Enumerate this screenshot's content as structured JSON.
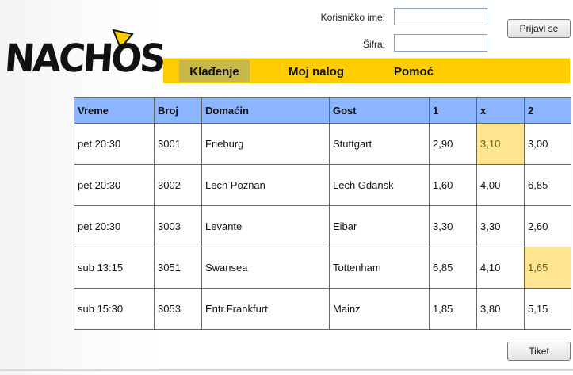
{
  "brand": {
    "logo_text": "NACHOS",
    "accent": "#ffcc00"
  },
  "login": {
    "username_label": "Korisničko ime:",
    "password_label": "Šifra:",
    "username_value": "",
    "password_value": "",
    "submit_label": "Prijavi se"
  },
  "nav": {
    "tabs": [
      {
        "label": "Klađenje",
        "active": true
      },
      {
        "label": "Moj nalog",
        "active": false
      },
      {
        "label": "Pomoć",
        "active": false
      }
    ]
  },
  "table": {
    "headers": [
      "Vreme",
      "Broj",
      "Domaćin",
      "Gost",
      "1",
      "x",
      "2"
    ],
    "rows": [
      {
        "vreme": "pet 20:30",
        "broj": "3001",
        "domacin": "Frieburg",
        "gost": "Stuttgart",
        "k1": "2,90",
        "kx": "3,10",
        "k2": "3,00",
        "selected": "x"
      },
      {
        "vreme": "pet 20:30",
        "broj": "3002",
        "domacin": "Lech Poznan",
        "gost": "Lech Gdansk",
        "k1": "1,60",
        "kx": "4,00",
        "k2": "6,85",
        "selected": ""
      },
      {
        "vreme": "pet 20:30",
        "broj": "3003",
        "domacin": "Levante",
        "gost": "Eibar",
        "k1": "3,30",
        "kx": "3,30",
        "k2": "2,60",
        "selected": ""
      },
      {
        "vreme": "sub 13:15",
        "broj": "3051",
        "domacin": "Swansea",
        "gost": "Tottenham",
        "k1": "6,85",
        "kx": "4,10",
        "k2": "1,65",
        "selected": "2"
      },
      {
        "vreme": "sub 15:30",
        "broj": "3053",
        "domacin": "Entr.Frankfurt",
        "gost": "Mainz",
        "k1": "1,85",
        "kx": "3,80",
        "k2": "5,15",
        "selected": ""
      }
    ],
    "header_color": "#8bb5ff",
    "selected_color": "#ffe58f"
  },
  "ticket": {
    "label": "Tiket"
  }
}
